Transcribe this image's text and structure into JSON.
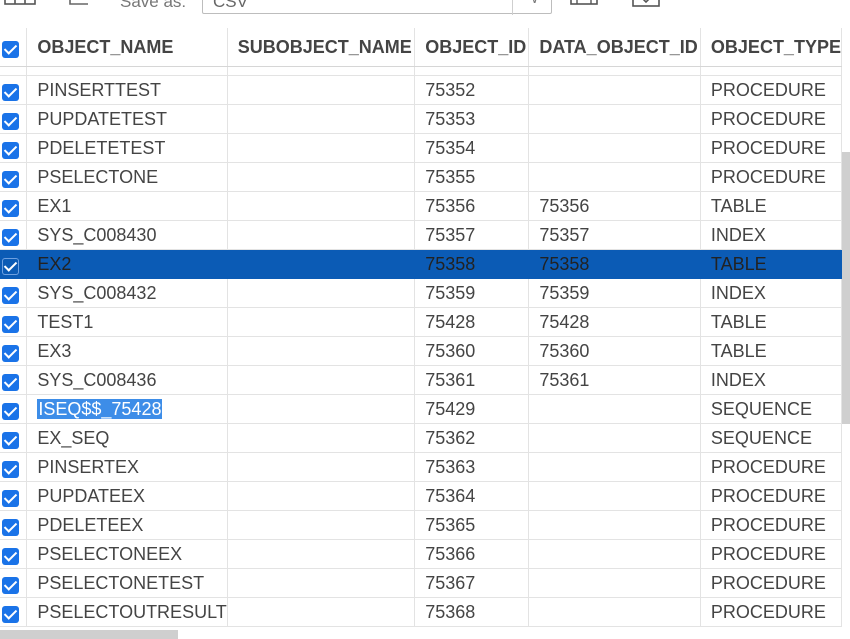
{
  "toolbar": {
    "save_label": "Save as:",
    "format_value": "CSV",
    "icons": [
      "grid-icon",
      "export-icon",
      "save-icon",
      "download-icon"
    ]
  },
  "grid": {
    "columns": [
      "OBJECT_NAME",
      "SUBOBJECT_NAME",
      "OBJECT_ID",
      "DATA_OBJECT_ID",
      "OBJECT_TYPE"
    ],
    "rows": [
      {
        "name": "PINSERTTEST",
        "sub": "",
        "id": "75352",
        "data_id": "",
        "type": "PROCEDURE"
      },
      {
        "name": "PUPDATETEST",
        "sub": "",
        "id": "75353",
        "data_id": "",
        "type": "PROCEDURE"
      },
      {
        "name": "PDELETETEST",
        "sub": "",
        "id": "75354",
        "data_id": "",
        "type": "PROCEDURE"
      },
      {
        "name": "PSELECTONE",
        "sub": "",
        "id": "75355",
        "data_id": "",
        "type": "PROCEDURE"
      },
      {
        "name": "EX1",
        "sub": "",
        "id": "75356",
        "data_id": "75356",
        "type": "TABLE"
      },
      {
        "name": "SYS_C008430",
        "sub": "",
        "id": "75357",
        "data_id": "75357",
        "type": "INDEX"
      },
      {
        "name": "EX2",
        "sub": "",
        "id": "75358",
        "data_id": "75358",
        "type": "TABLE"
      },
      {
        "name": "SYS_C008432",
        "sub": "",
        "id": "75359",
        "data_id": "75359",
        "type": "INDEX"
      },
      {
        "name": "TEST1",
        "sub": "",
        "id": "75428",
        "data_id": "75428",
        "type": "TABLE"
      },
      {
        "name": "EX3",
        "sub": "",
        "id": "75360",
        "data_id": "75360",
        "type": "TABLE"
      },
      {
        "name": "SYS_C008436",
        "sub": "",
        "id": "75361",
        "data_id": "75361",
        "type": "INDEX"
      },
      {
        "name": "ISEQ$$_75428",
        "sub": "",
        "id": "75429",
        "data_id": "",
        "type": "SEQUENCE"
      },
      {
        "name": "EX_SEQ",
        "sub": "",
        "id": "75362",
        "data_id": "",
        "type": "SEQUENCE"
      },
      {
        "name": "PINSERTEX",
        "sub": "",
        "id": "75363",
        "data_id": "",
        "type": "PROCEDURE"
      },
      {
        "name": "PUPDATEEX",
        "sub": "",
        "id": "75364",
        "data_id": "",
        "type": "PROCEDURE"
      },
      {
        "name": "PDELETEEX",
        "sub": "",
        "id": "75365",
        "data_id": "",
        "type": "PROCEDURE"
      },
      {
        "name": "PSELECTONEEX",
        "sub": "",
        "id": "75366",
        "data_id": "",
        "type": "PROCEDURE"
      },
      {
        "name": "PSELECTONETEST",
        "sub": "",
        "id": "75367",
        "data_id": "",
        "type": "PROCEDURE"
      },
      {
        "name": "PSELECTOUTRESULT",
        "sub": "",
        "id": "75368",
        "data_id": "",
        "type": "PROCEDURE"
      }
    ],
    "selected_row": 6,
    "highlighted_cell_row": 11
  },
  "colors": {
    "accent": "#1a73e8",
    "selected_row": "#0b5bb5",
    "text_highlight": "#3d8de8"
  }
}
